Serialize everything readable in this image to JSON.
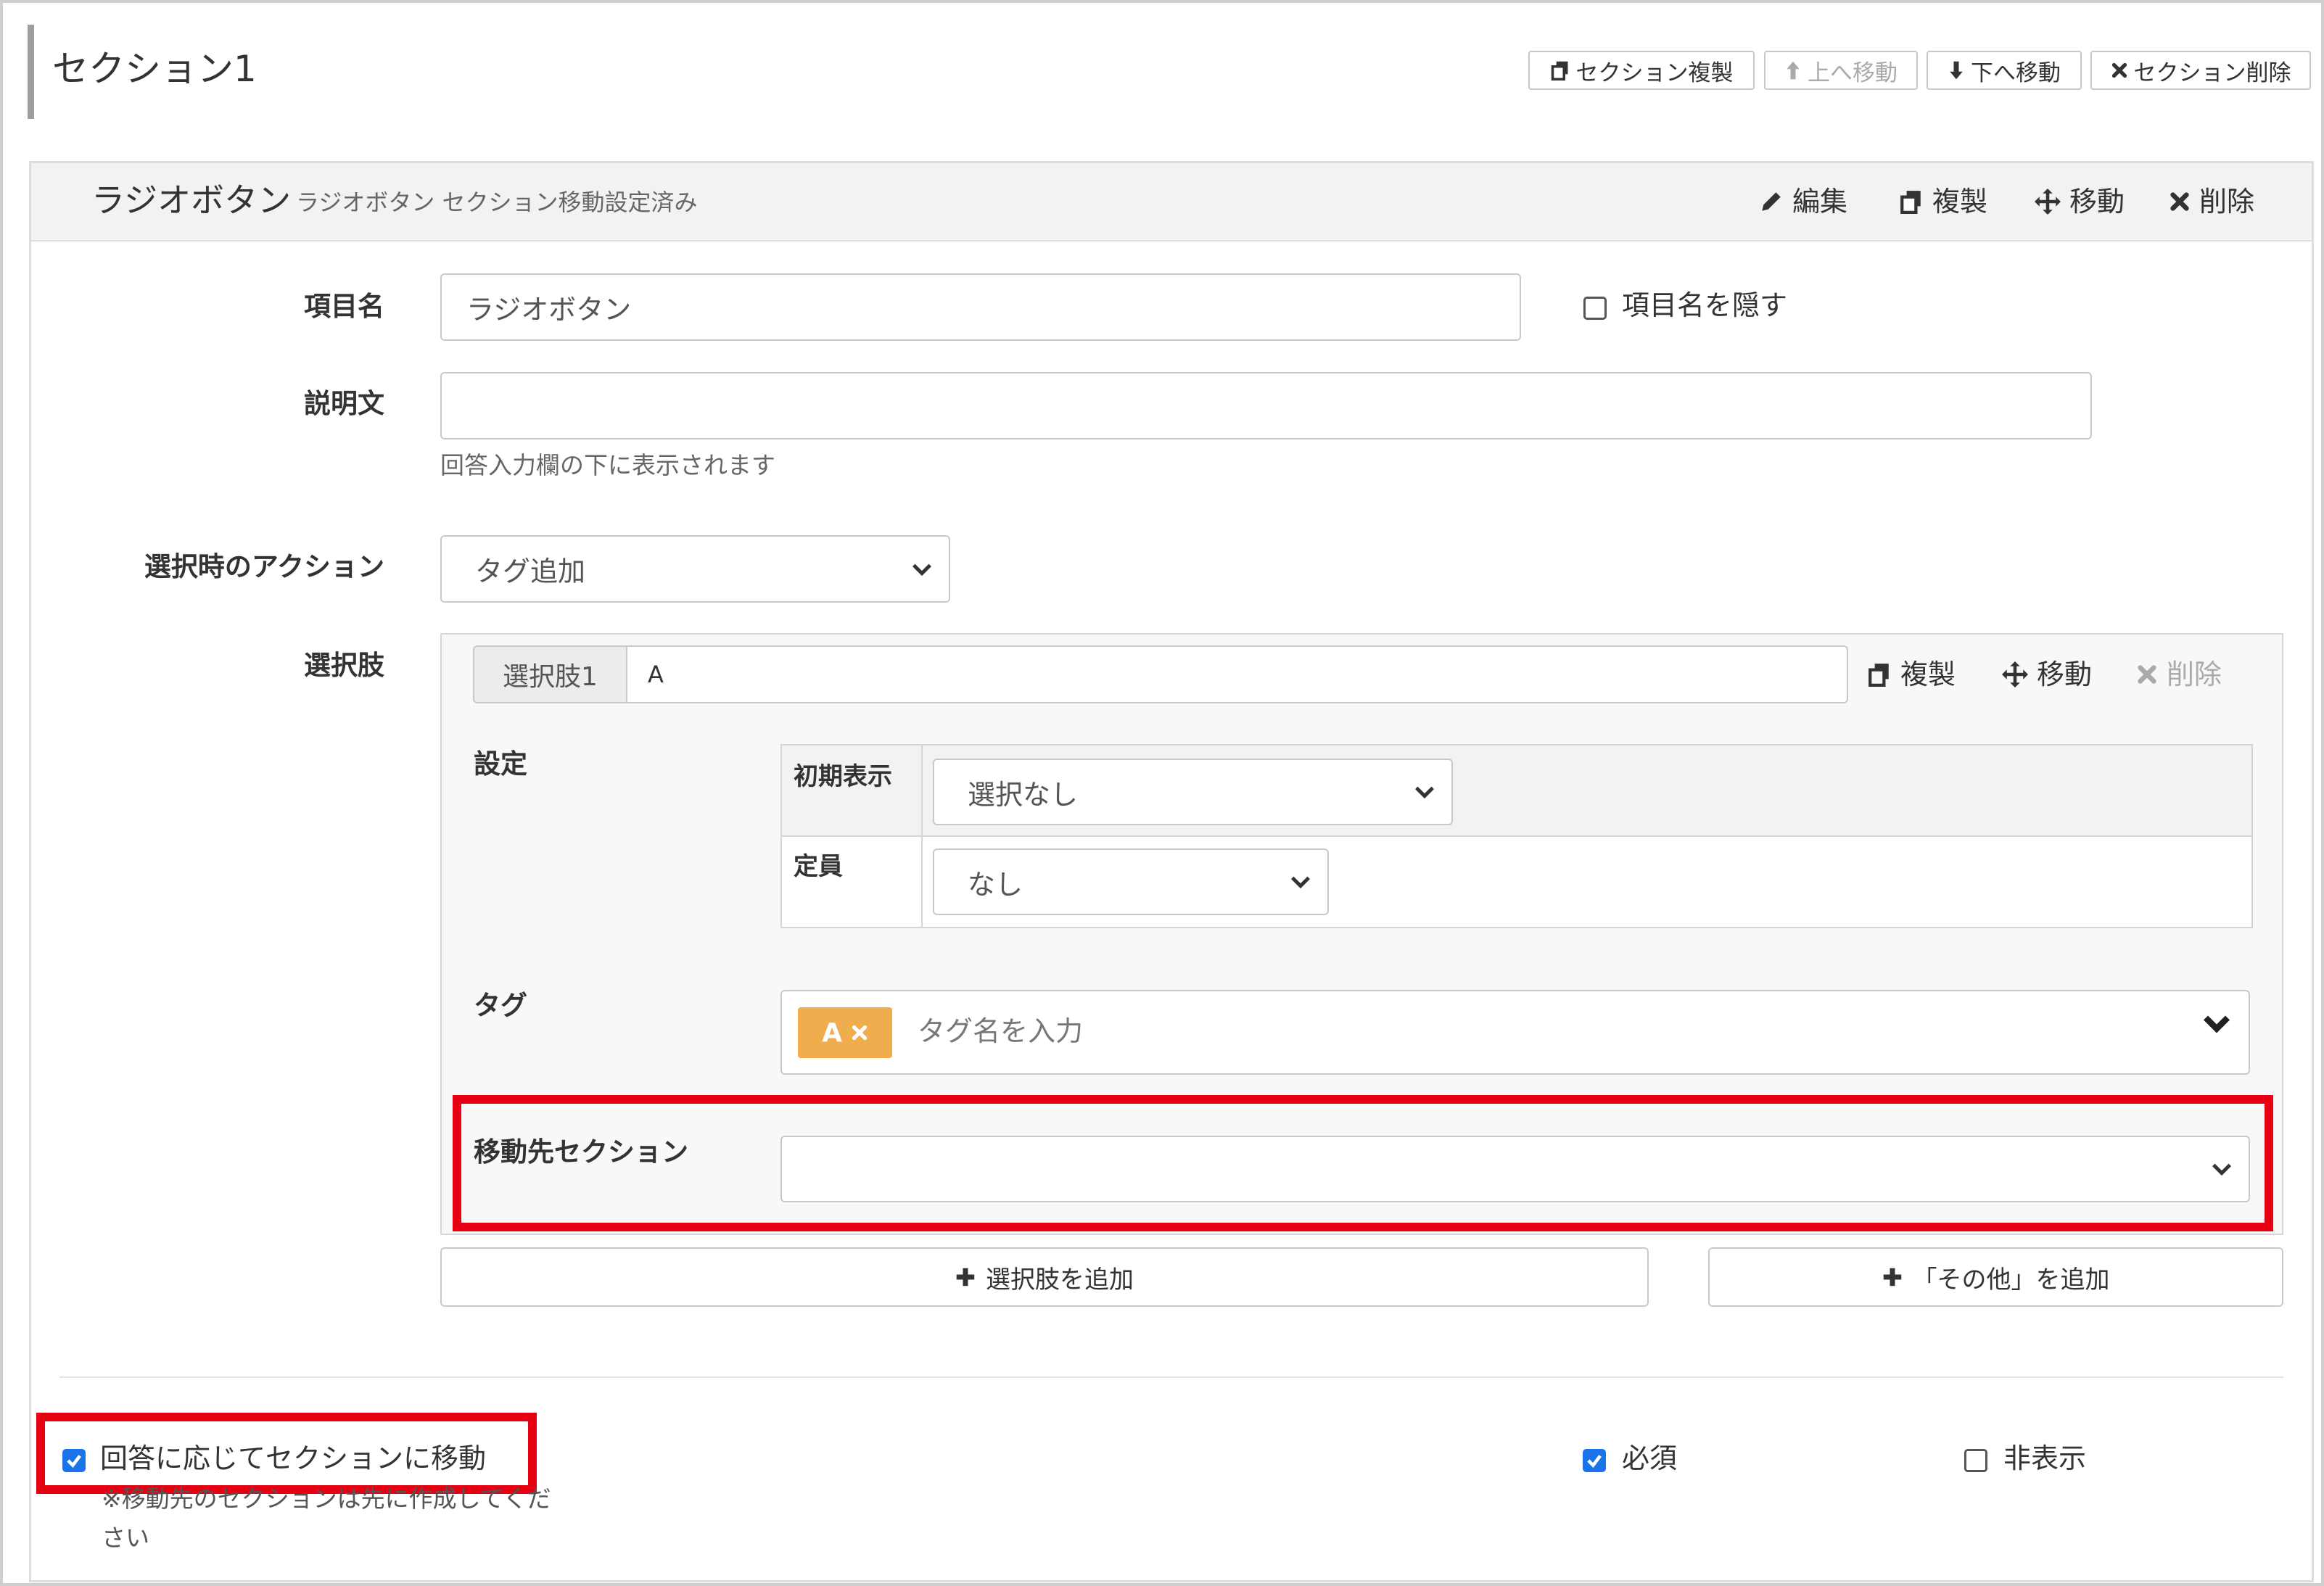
{
  "section": {
    "title": "セクション1",
    "toolbar": {
      "duplicate": "セクション複製",
      "move_up": "上へ移動",
      "move_down": "下へ移動",
      "delete": "セクション削除"
    }
  },
  "item": {
    "title": "ラジオボタン",
    "subtitle": "ラジオボタン セクション移動設定済み",
    "actions": {
      "edit": "編集",
      "duplicate": "複製",
      "move": "移動",
      "delete": "削除"
    },
    "name_label": "項目名",
    "name_value": "ラジオボタン",
    "hide_name_label": "項目名を隠す",
    "description_label": "説明文",
    "description_value": "",
    "description_help": "回答入力欄の下に表示されます",
    "action_label": "選択時のアクション",
    "action_value": "タグ追加",
    "choices_label": "選択肢"
  },
  "choice": {
    "addon_label": "選択肢1",
    "value": "A",
    "actions": {
      "duplicate": "複製",
      "move": "移動",
      "delete": "削除"
    },
    "settings_label": "設定",
    "initial_label": "初期表示",
    "initial_value": "選択なし",
    "capacity_label": "定員",
    "capacity_value": "なし",
    "tag_label": "タグ",
    "tag_chip": "A",
    "tag_placeholder": "タグ名を入力",
    "dest_label": "移動先セクション",
    "dest_value": ""
  },
  "buttons": {
    "add_choice": "選択肢を追加",
    "add_other": "「その他」を追加"
  },
  "footer": {
    "move_by_answer": "回答に応じてセクションに移動",
    "note": "※移動先のセクションは先に作成してください",
    "required": "必須",
    "hidden": "非表示"
  },
  "colors": {
    "highlight": "#e60012",
    "tag_chip": "#f0ad4e",
    "checkbox": "#1a73e8"
  },
  "icons": [
    "copy-icon",
    "arrow-up-icon",
    "arrow-down-icon",
    "close-icon",
    "pencil-icon",
    "move-icon",
    "chevron-down-icon",
    "plus-icon",
    "check-icon"
  ]
}
